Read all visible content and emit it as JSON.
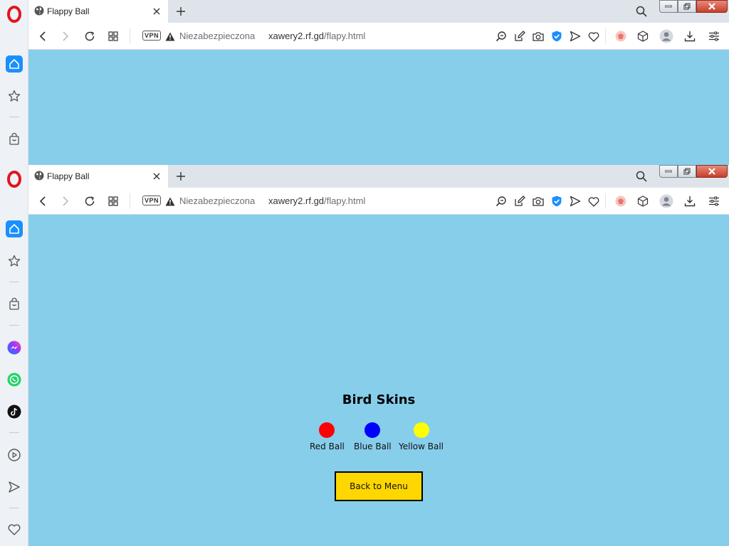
{
  "browser": {
    "tab_title": "Flappy Ball",
    "vpn_label": "VPN",
    "security_text": "Niezabezpieczona",
    "url_host": "xawery2.rf.gd",
    "url_path": "/flapy.html"
  },
  "game": {
    "heading": "Bird Skins",
    "skins": [
      {
        "label": "Red Ball",
        "color": "#ff0000"
      },
      {
        "label": "Blue Ball",
        "color": "#0000ff"
      },
      {
        "label": "Yellow Ball",
        "color": "#ffff00"
      }
    ],
    "back_label": "Back to Menu"
  },
  "colors": {
    "page_bg": "#87ceeb",
    "button_bg": "#ffd700",
    "opera_red": "#e3141e",
    "accent_blue": "#1a8fff"
  },
  "sidebar_icons": [
    "opera-logo-icon",
    "home-icon",
    "star-icon",
    "bag-icon",
    "messenger-icon",
    "whatsapp-icon",
    "tiktok-icon",
    "player-icon",
    "send-icon",
    "heart-icon"
  ]
}
